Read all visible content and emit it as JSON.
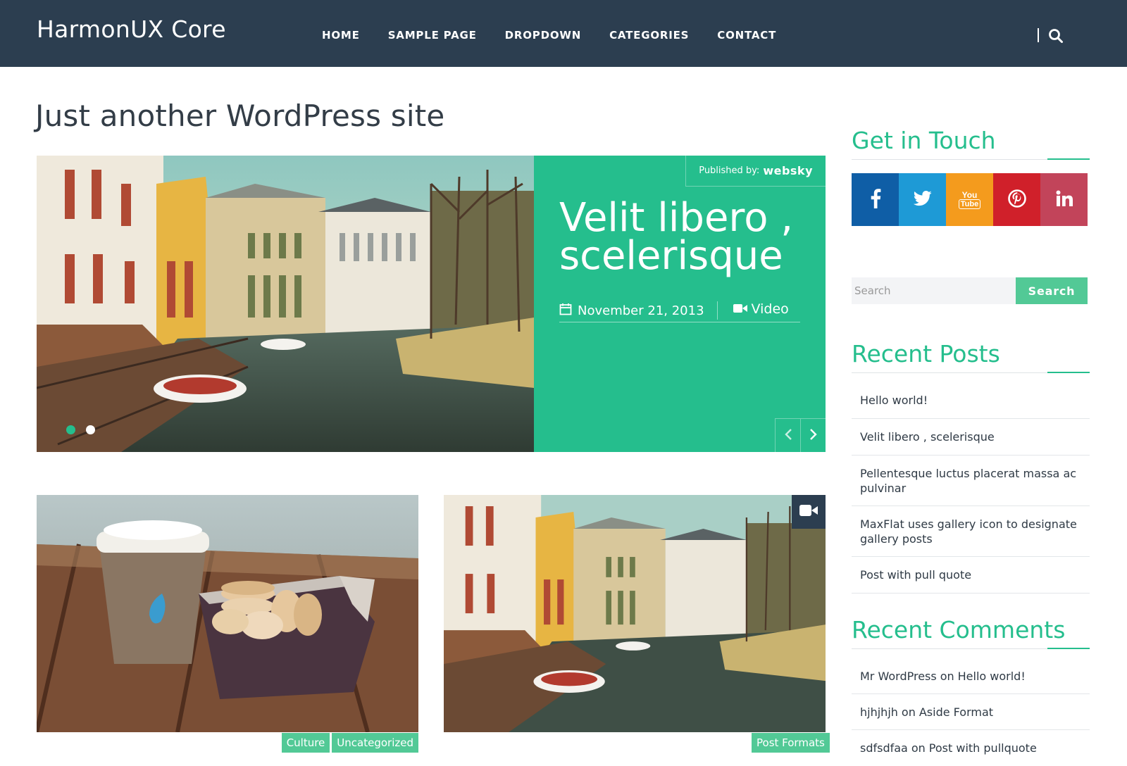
{
  "site": {
    "title": "HarmonUX Core",
    "tagline": "Just another WordPress site"
  },
  "nav": {
    "items": [
      "HOME",
      "SAMPLE PAGE",
      "DROPDOWN",
      "CATEGORIES",
      "CONTACT"
    ]
  },
  "featured": {
    "published_label": "Published by:",
    "author": "websky",
    "title": "Velit libero , scelerisque",
    "date": "November 21, 2013",
    "format": "Video"
  },
  "cards": [
    {
      "categories": [
        "Culture",
        "Uncategorized"
      ]
    },
    {
      "categories": [
        "Post Formats"
      ],
      "format_icon": "video-camera-icon"
    }
  ],
  "sidebar": {
    "get_in_touch_title": "Get in Touch",
    "social": [
      {
        "name": "facebook",
        "color": "#0f5ea6"
      },
      {
        "name": "twitter",
        "color": "#1e9ad6"
      },
      {
        "name": "youtube",
        "color": "#f49b1d",
        "label_top": "You",
        "label_bottom": "Tube"
      },
      {
        "name": "pinterest",
        "color": "#d0202a"
      },
      {
        "name": "linkedin",
        "color": "#c2445a"
      }
    ],
    "search": {
      "placeholder": "Search",
      "button_label": "Search"
    },
    "recent_posts_title": "Recent Posts",
    "recent_posts": [
      "Hello world!",
      "Velit libero , scelerisque",
      "Pellentesque luctus placerat massa ac pulvinar",
      "MaxFlat uses gallery icon to designate gallery posts",
      "Post with pull quote"
    ],
    "recent_comments_title": "Recent Comments",
    "recent_comments": [
      {
        "author": "Mr WordPress",
        "on": "on",
        "post": "Hello world!"
      },
      {
        "author": "hjhjhjh",
        "on": "on",
        "post": "Aside Format"
      },
      {
        "author": "sdfsdfaa",
        "on": "on",
        "post": "Post with pullquote"
      }
    ]
  },
  "colors": {
    "header": "#2c3e50",
    "accent": "#25be8d",
    "tag": "#52c996"
  }
}
